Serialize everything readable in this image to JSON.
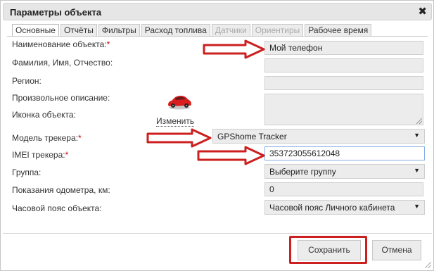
{
  "dialog": {
    "title": "Параметры объекта",
    "close_icon": "✖"
  },
  "tabs": [
    {
      "label": "Основные",
      "state": "active"
    },
    {
      "label": "Отчёты",
      "state": "normal"
    },
    {
      "label": "Фильтры",
      "state": "normal"
    },
    {
      "label": "Расход топлива",
      "state": "normal"
    },
    {
      "label": "Датчики",
      "state": "disabled"
    },
    {
      "label": "Ориентиры",
      "state": "disabled"
    },
    {
      "label": "Рабочее время",
      "state": "normal"
    }
  ],
  "form": {
    "name_label": "Наименование объекта:",
    "name_value": "Мой телефон",
    "fio_label": "Фамилия, Имя, Отчество:",
    "fio_value": "",
    "region_label": "Регион:",
    "region_value": "",
    "description_label": "Произвольное описание:",
    "description_value": "",
    "icon_label": "Иконка объекта:",
    "icon_change": "Изменить",
    "tracker_model_label": "Модель трекера:",
    "tracker_model_value": "GPShome Tracker",
    "imei_label": "IMEI трекера:",
    "imei_value": "353723055612048",
    "group_label": "Группа:",
    "group_value": "Выберите группу",
    "odometer_label": "Показания одометра, км:",
    "odometer_value": "0",
    "timezone_label": "Часовой пояс объекта:",
    "timezone_value": "Часовой пояс Личного кабинета",
    "required_mark": "*",
    "select_arrow": "▼"
  },
  "buttons": {
    "save": "Сохранить",
    "cancel": "Отмена"
  },
  "colors": {
    "required": "#cc0000",
    "annotation": "#cc1f1f",
    "focus_border": "#86aee6"
  },
  "icons": {
    "car": "car-icon",
    "close": "close-icon",
    "dropdown": "chevron-down-icon"
  }
}
